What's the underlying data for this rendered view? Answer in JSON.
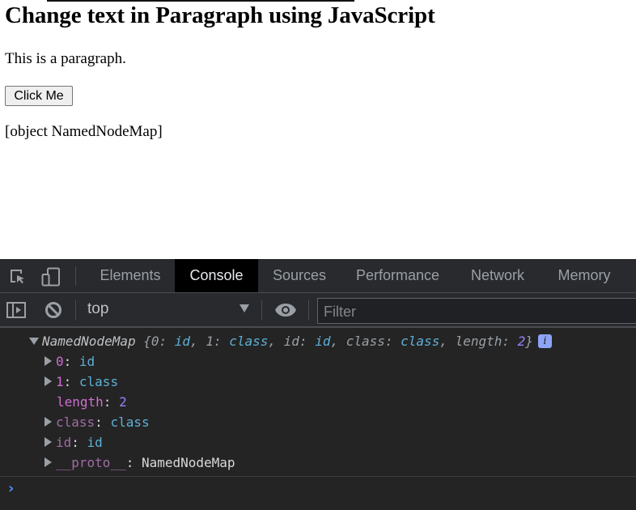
{
  "page": {
    "heading": "Change text in Paragraph using JavaScript",
    "paragraph": "This is a paragraph.",
    "button_label": "Click Me",
    "result_text": "[object NamedNodeMap]"
  },
  "devtools": {
    "tabs": [
      {
        "label": "Elements",
        "active": false
      },
      {
        "label": "Console",
        "active": true
      },
      {
        "label": "Sources",
        "active": false
      },
      {
        "label": "Performance",
        "active": false
      },
      {
        "label": "Network",
        "active": false
      },
      {
        "label": "Memory",
        "active": false
      }
    ],
    "toolbar": {
      "context": "top",
      "filter_placeholder": "Filter"
    },
    "icons": {
      "inspect": "inspect-element-icon",
      "device": "device-toolbar-icon",
      "sidebar": "show-sidebar-icon",
      "clear": "clear-console-icon",
      "dropdown": "dropdown-arrow-icon",
      "eye": "live-expression-eye-icon",
      "info": "info-icon",
      "prompt": "prompt-chevron-icon"
    },
    "console": {
      "summary": {
        "name": "NamedNodeMap",
        "open": "{",
        "entries": [
          {
            "k": "0",
            "v": "id"
          },
          {
            "k": "1",
            "v": "class"
          },
          {
            "k": "id",
            "v": "id"
          },
          {
            "k": "class",
            "v": "class"
          },
          {
            "k": "length",
            "v": "2"
          }
        ],
        "close": "}",
        "info_glyph": "i"
      },
      "props": [
        {
          "key": "0",
          "value": "id",
          "expandable": true
        },
        {
          "key": "1",
          "value": "class",
          "expandable": true
        },
        {
          "key": "length",
          "value": "2",
          "expandable": false
        },
        {
          "key": "class",
          "value": "class",
          "expandable": true
        },
        {
          "key": "id",
          "value": "id",
          "expandable": true
        },
        {
          "key": "__proto__",
          "value": "NamedNodeMap",
          "expandable": true
        }
      ],
      "prompt_glyph": "›"
    }
  }
}
